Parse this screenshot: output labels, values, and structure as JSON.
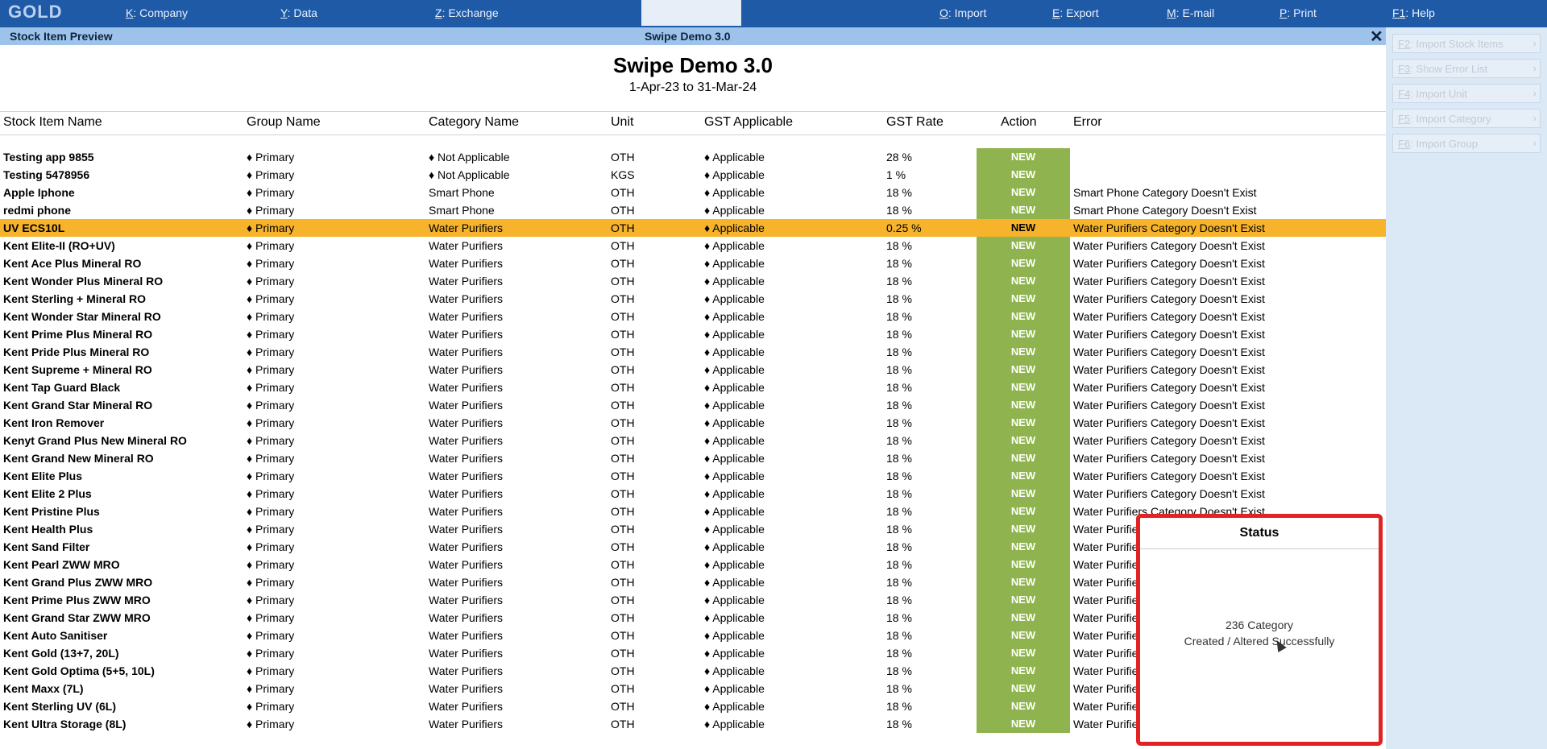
{
  "topbar": {
    "brand": "GOLD",
    "menus": [
      {
        "key": "K",
        "label": ": Company"
      },
      {
        "key": "Y",
        "label": ": Data"
      },
      {
        "key": "Z",
        "label": ": Exchange"
      },
      {
        "key": "O",
        "label": ": Import"
      },
      {
        "key": "E",
        "label": ": Export"
      },
      {
        "key": "M",
        "label": ": E-mail"
      },
      {
        "key": "P",
        "label": ": Print"
      },
      {
        "key": "F1",
        "label": ": Help"
      }
    ]
  },
  "titlebar": {
    "left": "Stock Item Preview",
    "center": "Swipe Demo 3.0",
    "close": "✕"
  },
  "right_panel": {
    "buttons": [
      {
        "key": "F2",
        "label": ": Import Stock Items"
      },
      {
        "key": "F3",
        "label": ": Show Error List"
      },
      {
        "key": "F4",
        "label": ": Import Unit"
      },
      {
        "key": "F5",
        "label": ": Import Category"
      },
      {
        "key": "F6",
        "label": ": Import Group"
      }
    ],
    "arrow": "›"
  },
  "report": {
    "title": "Swipe Demo 3.0",
    "period": "1-Apr-23 to 31-Mar-24"
  },
  "columns": [
    "Stock Item Name",
    "Group Name",
    "Category Name",
    "Unit",
    "GST Applicable",
    "GST Rate",
    "Action",
    "Error"
  ],
  "rows": [
    {
      "name": "Testing app 9855",
      "group": "♦ Primary",
      "category": "♦ Not Applicable",
      "unit": "OTH",
      "gst": "♦ Applicable",
      "rate": "28 %",
      "action": "NEW",
      "error": ""
    },
    {
      "name": "Testing 5478956",
      "group": "♦ Primary",
      "category": "♦ Not Applicable",
      "unit": "KGS",
      "gst": "♦ Applicable",
      "rate": "1 %",
      "action": "NEW",
      "error": ""
    },
    {
      "name": "Apple Iphone",
      "group": "♦ Primary",
      "category": "Smart Phone",
      "unit": "OTH",
      "gst": "♦ Applicable",
      "rate": "18 %",
      "action": "NEW",
      "error": "Smart Phone Category Doesn't Exist"
    },
    {
      "name": "redmi phone",
      "group": "♦ Primary",
      "category": "Smart Phone",
      "unit": "OTH",
      "gst": "♦ Applicable",
      "rate": "18 %",
      "action": "NEW",
      "error": "Smart Phone Category Doesn't Exist"
    },
    {
      "name": "UV ECS10L",
      "group": "♦ Primary",
      "category": "Water Purifiers",
      "unit": "OTH",
      "gst": "♦ Applicable",
      "rate": "0.25 %",
      "action": "NEW",
      "error": "Water Purifiers Category Doesn't Exist",
      "selected": true
    },
    {
      "name": "Kent Elite-II (RO+UV)",
      "group": "♦ Primary",
      "category": "Water Purifiers",
      "unit": "OTH",
      "gst": "♦ Applicable",
      "rate": "18 %",
      "action": "NEW",
      "error": "Water Purifiers Category Doesn't Exist"
    },
    {
      "name": "Kent Ace Plus Mineral RO",
      "group": "♦ Primary",
      "category": "Water Purifiers",
      "unit": "OTH",
      "gst": "♦ Applicable",
      "rate": "18 %",
      "action": "NEW",
      "error": "Water Purifiers Category Doesn't Exist"
    },
    {
      "name": "Kent Wonder Plus Mineral RO",
      "group": "♦ Primary",
      "category": "Water Purifiers",
      "unit": "OTH",
      "gst": "♦ Applicable",
      "rate": "18 %",
      "action": "NEW",
      "error": "Water Purifiers Category Doesn't Exist"
    },
    {
      "name": "Kent Sterling + Mineral RO",
      "group": "♦ Primary",
      "category": "Water Purifiers",
      "unit": "OTH",
      "gst": "♦ Applicable",
      "rate": "18 %",
      "action": "NEW",
      "error": "Water Purifiers Category Doesn't Exist"
    },
    {
      "name": "Kent Wonder Star Mineral RO",
      "group": "♦ Primary",
      "category": "Water Purifiers",
      "unit": "OTH",
      "gst": "♦ Applicable",
      "rate": "18 %",
      "action": "NEW",
      "error": "Water Purifiers Category Doesn't Exist"
    },
    {
      "name": "Kent Prime Plus Mineral RO",
      "group": "♦ Primary",
      "category": "Water Purifiers",
      "unit": "OTH",
      "gst": "♦ Applicable",
      "rate": "18 %",
      "action": "NEW",
      "error": "Water Purifiers Category Doesn't Exist"
    },
    {
      "name": "Kent Pride Plus Mineral RO",
      "group": "♦ Primary",
      "category": "Water Purifiers",
      "unit": "OTH",
      "gst": "♦ Applicable",
      "rate": "18 %",
      "action": "NEW",
      "error": "Water Purifiers Category Doesn't Exist"
    },
    {
      "name": "Kent Supreme + Mineral RO",
      "group": "♦ Primary",
      "category": "Water Purifiers",
      "unit": "OTH",
      "gst": "♦ Applicable",
      "rate": "18 %",
      "action": "NEW",
      "error": "Water Purifiers Category Doesn't Exist"
    },
    {
      "name": "Kent Tap Guard Black",
      "group": "♦ Primary",
      "category": "Water Purifiers",
      "unit": "OTH",
      "gst": "♦ Applicable",
      "rate": "18 %",
      "action": "NEW",
      "error": "Water Purifiers Category Doesn't Exist"
    },
    {
      "name": "Kent Grand Star Mineral RO",
      "group": "♦ Primary",
      "category": "Water Purifiers",
      "unit": "OTH",
      "gst": "♦ Applicable",
      "rate": "18 %",
      "action": "NEW",
      "error": "Water Purifiers Category Doesn't Exist"
    },
    {
      "name": "Kent Iron Remover",
      "group": "♦ Primary",
      "category": "Water Purifiers",
      "unit": "OTH",
      "gst": "♦ Applicable",
      "rate": "18 %",
      "action": "NEW",
      "error": "Water Purifiers Category Doesn't Exist"
    },
    {
      "name": "Kenyt Grand Plus New Mineral RO",
      "group": "♦ Primary",
      "category": "Water Purifiers",
      "unit": "OTH",
      "gst": "♦ Applicable",
      "rate": "18 %",
      "action": "NEW",
      "error": "Water Purifiers Category Doesn't Exist"
    },
    {
      "name": "Kent Grand New Mineral RO",
      "group": "♦ Primary",
      "category": "Water Purifiers",
      "unit": "OTH",
      "gst": "♦ Applicable",
      "rate": "18 %",
      "action": "NEW",
      "error": "Water Purifiers Category Doesn't Exist"
    },
    {
      "name": "Kent Elite Plus",
      "group": "♦ Primary",
      "category": "Water Purifiers",
      "unit": "OTH",
      "gst": "♦ Applicable",
      "rate": "18 %",
      "action": "NEW",
      "error": "Water Purifiers Category Doesn't Exist"
    },
    {
      "name": "Kent Elite 2 Plus",
      "group": "♦ Primary",
      "category": "Water Purifiers",
      "unit": "OTH",
      "gst": "♦ Applicable",
      "rate": "18 %",
      "action": "NEW",
      "error": "Water Purifiers Category Doesn't Exist"
    },
    {
      "name": "Kent Pristine Plus",
      "group": "♦ Primary",
      "category": "Water Purifiers",
      "unit": "OTH",
      "gst": "♦ Applicable",
      "rate": "18 %",
      "action": "NEW",
      "error": "Water Purifiers Category Doesn't Exist"
    },
    {
      "name": "Kent Health Plus",
      "group": "♦ Primary",
      "category": "Water Purifiers",
      "unit": "OTH",
      "gst": "♦ Applicable",
      "rate": "18 %",
      "action": "NEW",
      "error": "Water Purifiers Category Doesn't Exist"
    },
    {
      "name": "Kent Sand Filter",
      "group": "♦ Primary",
      "category": "Water Purifiers",
      "unit": "OTH",
      "gst": "♦ Applicable",
      "rate": "18 %",
      "action": "NEW",
      "error": "Water Purifiers Category Doesn't Exist"
    },
    {
      "name": "Kent Pearl ZWW MRO",
      "group": "♦ Primary",
      "category": "Water Purifiers",
      "unit": "OTH",
      "gst": "♦ Applicable",
      "rate": "18 %",
      "action": "NEW",
      "error": "Water Purifiers Category Doesn't Exist"
    },
    {
      "name": "Kent Grand Plus ZWW MRO",
      "group": "♦ Primary",
      "category": "Water Purifiers",
      "unit": "OTH",
      "gst": "♦ Applicable",
      "rate": "18 %",
      "action": "NEW",
      "error": "Water Purifiers Category Doesn't Exist"
    },
    {
      "name": "Kent Prime Plus ZWW MRO",
      "group": "♦ Primary",
      "category": "Water Purifiers",
      "unit": "OTH",
      "gst": "♦ Applicable",
      "rate": "18 %",
      "action": "NEW",
      "error": "Water Purifiers Category Doesn't Exist"
    },
    {
      "name": "Kent Grand Star ZWW MRO",
      "group": "♦ Primary",
      "category": "Water Purifiers",
      "unit": "OTH",
      "gst": "♦ Applicable",
      "rate": "18 %",
      "action": "NEW",
      "error": "Water Purifiers Category Doesn't Exist"
    },
    {
      "name": "Kent Auto Sanitiser",
      "group": "♦ Primary",
      "category": "Water Purifiers",
      "unit": "OTH",
      "gst": "♦ Applicable",
      "rate": "18 %",
      "action": "NEW",
      "error": "Water Purifiers Category Doesn't Exist"
    },
    {
      "name": "Kent Gold (13+7, 20L)",
      "group": "♦ Primary",
      "category": "Water Purifiers",
      "unit": "OTH",
      "gst": "♦ Applicable",
      "rate": "18 %",
      "action": "NEW",
      "error": "Water Purifiers Category Doesn't Exist"
    },
    {
      "name": "Kent Gold Optima (5+5, 10L)",
      "group": "♦ Primary",
      "category": "Water Purifiers",
      "unit": "OTH",
      "gst": "♦ Applicable",
      "rate": "18 %",
      "action": "NEW",
      "error": "Water Purifiers Category Doesn't Exist"
    },
    {
      "name": "Kent Maxx (7L)",
      "group": "♦ Primary",
      "category": "Water Purifiers",
      "unit": "OTH",
      "gst": "♦ Applicable",
      "rate": "18 %",
      "action": "NEW",
      "error": "Water Purifiers Category Doesn't Exist"
    },
    {
      "name": "Kent Sterling UV (6L)",
      "group": "♦ Primary",
      "category": "Water Purifiers",
      "unit": "OTH",
      "gst": "♦ Applicable",
      "rate": "18 %",
      "action": "NEW",
      "error": "Water Purifiers Category Doesn't Exist"
    },
    {
      "name": "Kent Ultra Storage (8L)",
      "group": "♦ Primary",
      "category": "Water Purifiers",
      "unit": "OTH",
      "gst": "♦ Applicable",
      "rate": "18 %",
      "action": "NEW",
      "error": "Water Purifiers Category Doesn't Exist"
    }
  ],
  "status_popup": {
    "title": "Status",
    "line1": "236 Category",
    "line2": "Created / Altered Successfully"
  },
  "colors": {
    "topbar": "#1f5aa7",
    "titlebar": "#9ec3ea",
    "new_badge": "#8fb44f",
    "selected_row": "#f6b32b",
    "popup_border": "#e12323"
  }
}
